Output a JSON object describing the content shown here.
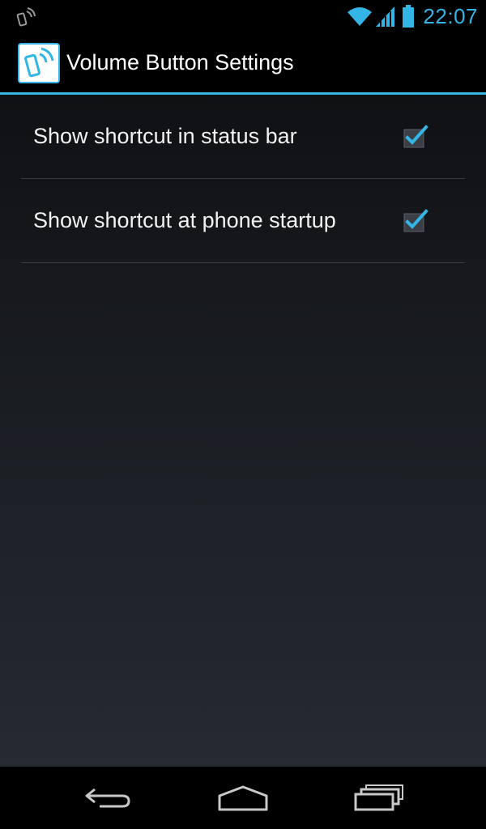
{
  "status_bar": {
    "time": "22:07",
    "left_icon": "notification-phone-waves-icon",
    "icons": [
      "wifi-icon",
      "signal-icon",
      "battery-icon"
    ],
    "accent_color": "#33b5e5"
  },
  "action_bar": {
    "title": "Volume Button Settings",
    "app_icon": "phone-waves-app-icon"
  },
  "preferences": [
    {
      "label": "Show shortcut in status bar",
      "checked": true
    },
    {
      "label": "Show shortcut at phone startup",
      "checked": true
    }
  ],
  "nav_bar": {
    "buttons": [
      "back-icon",
      "home-icon",
      "recent-apps-icon"
    ]
  },
  "colors": {
    "accent": "#33b5e5",
    "text": "#f2f2f2",
    "background_top": "#101114",
    "background_bottom": "#262a31"
  }
}
